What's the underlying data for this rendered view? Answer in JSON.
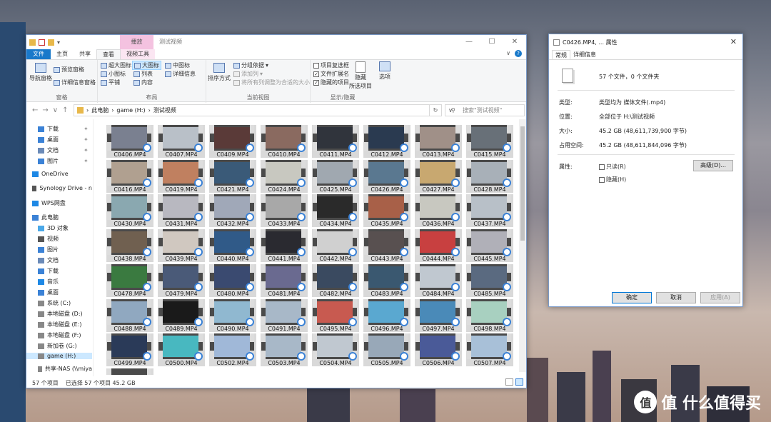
{
  "explorer": {
    "window_title": "测试视频",
    "context_tab": "播放",
    "tabs": [
      "文件",
      "主页",
      "共享",
      "查看",
      "视频工具"
    ],
    "ribbon": {
      "pane": {
        "nav_pane": "导航窗格",
        "preview": "预览窗格",
        "details": "详细信息窗格",
        "label": "窗格"
      },
      "layout": {
        "items": [
          "超大图标",
          "大图标",
          "中图标",
          "小图标",
          "列表",
          "详细信息",
          "平铺",
          "内容"
        ],
        "label": "布局"
      },
      "current_view": {
        "sort": "排序方式",
        "group": "分组依据",
        "add_col": "添加列",
        "fit": "将所有列调整为合适的大小",
        "label": "当前视图"
      },
      "show_hide": {
        "item_cb": "项目复选框",
        "ext": "文件扩展名",
        "hidden": "隐藏的项目",
        "hide_sel_1": "隐藏",
        "hide_sel_2": "所选项目",
        "options": "选项",
        "label": "显示/隐藏"
      }
    },
    "address": {
      "path": [
        "此电脑",
        "game (H:)",
        "测试视频"
      ],
      "search_placeholder": "搜索\"测试视频\""
    },
    "sidebar": [
      "下载",
      "桌面",
      "文档",
      "图片",
      "OneDrive",
      "Synology Drive - n",
      "WPS网盘",
      "此电脑",
      "3D 对象",
      "视频",
      "图片",
      "文档",
      "下载",
      "音乐",
      "桌面",
      "系统 (C:)",
      "本地磁盘 (D:)",
      "本地磁盘 (E:)",
      "本地磁盘 (F:)",
      "新加卷 (G:)",
      "game (H:)",
      "共享-NAS (\\\\miya"
    ],
    "files": [
      "C0406.MP4",
      "C0407.MP4",
      "C0409.MP4",
      "C0410.MP4",
      "C0411.MP4",
      "C0412.MP4",
      "C0413.MP4",
      "C0415.MP4",
      "C0416.MP4",
      "C0419.MP4",
      "C0421.MP4",
      "C0424.MP4",
      "C0425.MP4",
      "C0426.MP4",
      "C0427.MP4",
      "C0428.MP4",
      "C0430.MP4",
      "C0431.MP4",
      "C0432.MP4",
      "C0433.MP4",
      "C0434.MP4",
      "C0435.MP4",
      "C0436.MP4",
      "C0437.MP4",
      "C0438.MP4",
      "C0439.MP4",
      "C0440.MP4",
      "C0441.MP4",
      "C0442.MP4",
      "C0443.MP4",
      "C0444.MP4",
      "C0445.MP4",
      "C0478.MP4",
      "C0479.MP4",
      "C0480.MP4",
      "C0481.MP4",
      "C0482.MP4",
      "C0483.MP4",
      "C0484.MP4",
      "C0485.MP4",
      "C0488.MP4",
      "C0489.MP4",
      "C0490.MP4",
      "C0491.MP4",
      "C0495.MP4",
      "C0496.MP4",
      "C0497.MP4",
      "C0498.MP4",
      "C0499.MP4",
      "C0500.MP4",
      "C0502.MP4",
      "C0503.MP4",
      "C0504.MP4",
      "C0505.MP4",
      "C0506.MP4",
      "C0507.MP4",
      ""
    ],
    "status": {
      "count": "57 个项目",
      "selected": "已选择 57 个项目  45.2 GB"
    }
  },
  "properties": {
    "title": "C0426.MP4, ... 属性",
    "tabs": [
      "常规",
      "详细信息"
    ],
    "summary": "57 个文件，0 个文件夹",
    "type_label": "类型:",
    "type_value": "类型均为 媒体文件(.mp4)",
    "loc_label": "位置:",
    "loc_value": "全部位于 H:\\测试视频",
    "size_label": "大小:",
    "size_value": "45.2 GB (48,611,739,900 字节)",
    "disk_label": "占用空间:",
    "disk_value": "45.2 GB (48,611,844,096 字节)",
    "attr_label": "属性:",
    "readonly": "只读(R)",
    "hidden": "隐藏(H)",
    "advanced": "高级(D)...",
    "ok": "确定",
    "cancel": "取消",
    "apply": "应用(A)"
  },
  "watermark": "值 什么值得买"
}
